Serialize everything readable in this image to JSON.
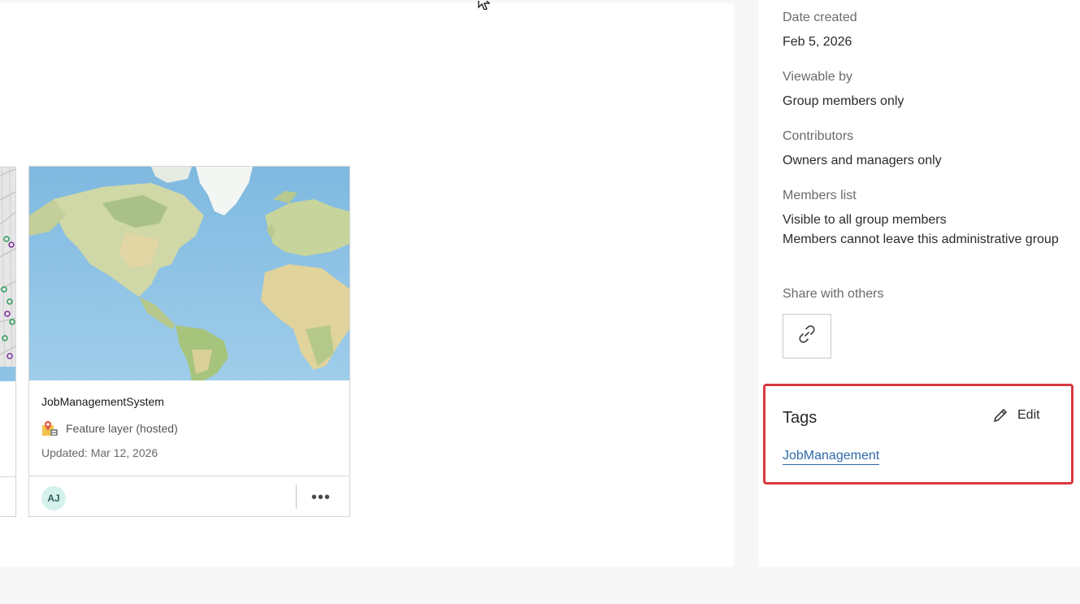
{
  "card": {
    "title": "JobManagementSystem",
    "type_label": "Feature layer (hosted)",
    "updated": "Updated: Mar 12, 2026",
    "owner_initials": "AJ",
    "more_label": "•••",
    "type_icon": "feature-layer-icon"
  },
  "details": {
    "date_created_label": "Date created",
    "date_created_value": "Feb 5, 2026",
    "viewable_label": "Viewable by",
    "viewable_value": "Group members only",
    "contributors_label": "Contributors",
    "contributors_value": "Owners and managers only",
    "members_label": "Members list",
    "members_value_1": "Visible to all group members",
    "members_value_2": "Members cannot leave this administrative group",
    "share_label": "Share with others",
    "share_icon": "link-icon"
  },
  "tags": {
    "title": "Tags",
    "edit_label": "Edit",
    "items": [
      "JobManagement"
    ]
  },
  "colors": {
    "highlight_border": "#d9383f",
    "link": "#2f6aa8",
    "avatar_bg": "#d5f1ec"
  }
}
